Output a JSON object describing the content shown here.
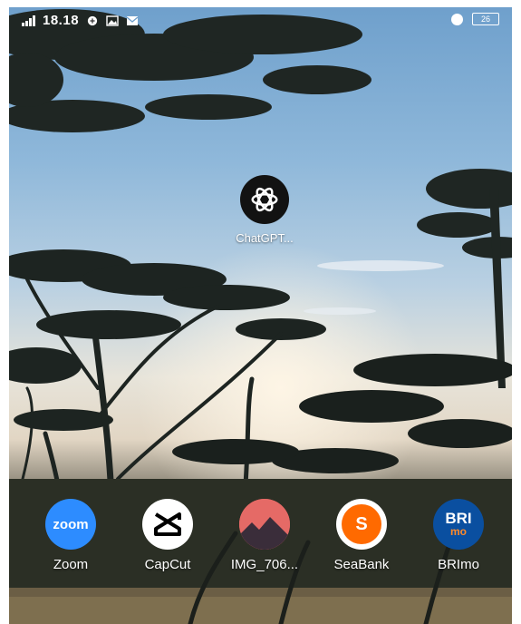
{
  "status_bar": {
    "time": "18.18",
    "battery": "26",
    "icons": [
      "signal-icon",
      "vpn-icon",
      "gallery-icon",
      "mail-icon",
      "alarm-icon",
      "battery-icon"
    ]
  },
  "home": {
    "apps": [
      {
        "label": "ChatGPT...",
        "icon": "chatgpt-icon"
      }
    ]
  },
  "dock": {
    "apps": [
      {
        "label": "Zoom",
        "icon": "zoom-icon",
        "icon_text": "zoom",
        "color": "#2d8cff"
      },
      {
        "label": "CapCut",
        "icon": "capcut-icon",
        "color": "#ffffff"
      },
      {
        "label": "IMG_706...",
        "icon": "image-file-icon",
        "color": "#e05a5a"
      },
      {
        "label": "SeaBank",
        "icon": "seabank-icon",
        "icon_text": "S",
        "color": "#ff6a00"
      },
      {
        "label": "BRImo",
        "icon": "brimo-icon",
        "icon_text": "BRI",
        "icon_subtext": "mo",
        "color": "#0a4fa0"
      }
    ]
  }
}
